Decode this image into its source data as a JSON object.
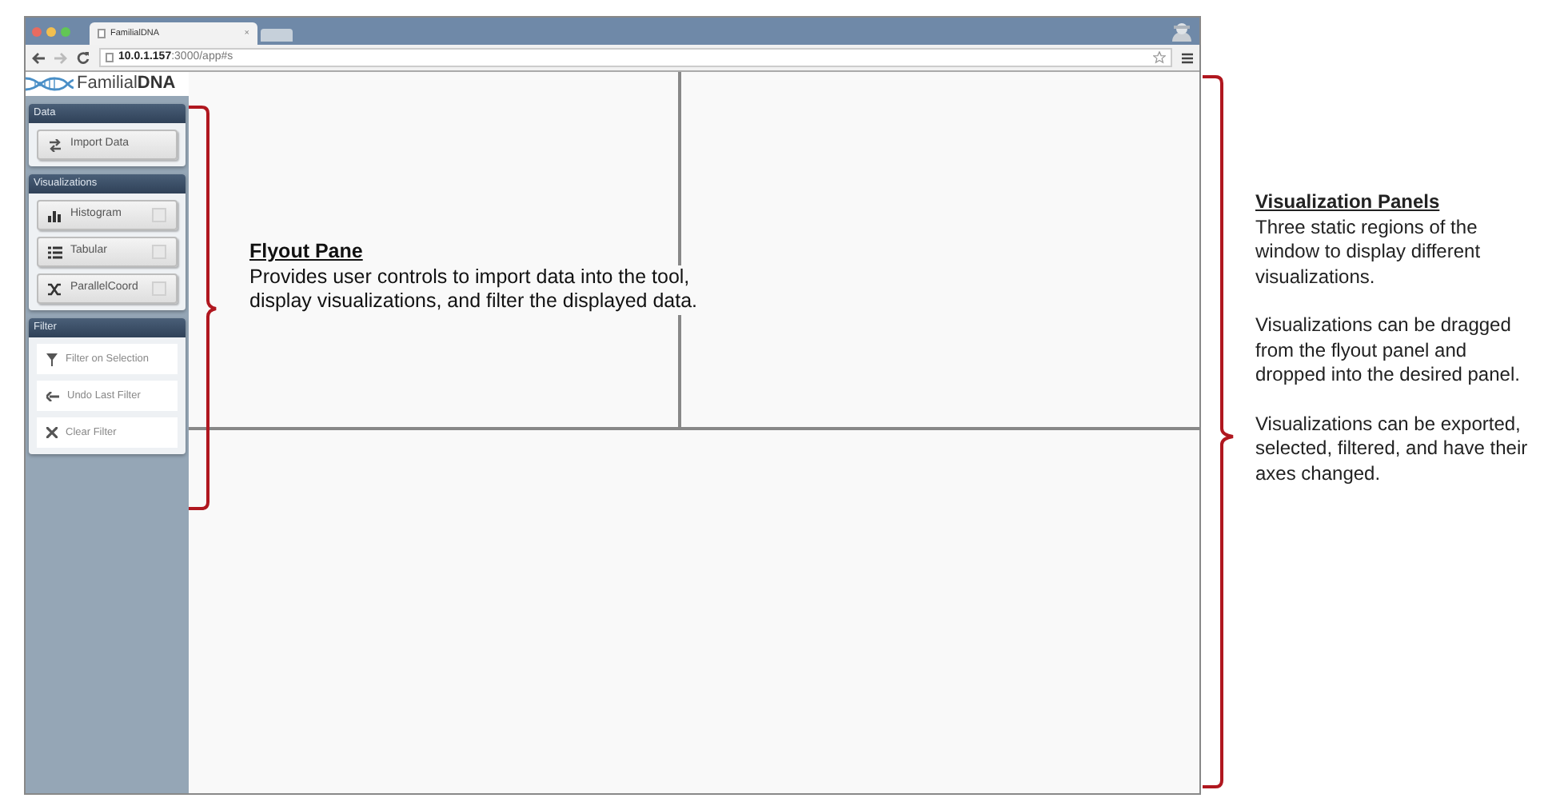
{
  "browser": {
    "tab_title": "FamilialDNA",
    "tab_close": "×",
    "url_host": "10.0.1.157",
    "url_path": ":3000/app#s"
  },
  "logo": {
    "light": "Familial",
    "bold": "DNA"
  },
  "sidebar": {
    "sections": [
      {
        "title": "Data",
        "items": [
          {
            "kind": "button",
            "label": "Import Data"
          }
        ]
      },
      {
        "title": "Visualizations",
        "items": [
          {
            "kind": "draggable",
            "label": "Histogram"
          },
          {
            "kind": "draggable",
            "label": "Tabular"
          },
          {
            "kind": "draggable",
            "label": "ParallelCoord"
          }
        ]
      },
      {
        "title": "Filter",
        "items": [
          {
            "kind": "action",
            "label": "Filter on Selection"
          },
          {
            "kind": "action",
            "label": "Undo Last Filter"
          },
          {
            "kind": "action",
            "label": "Clear Filter"
          }
        ]
      }
    ]
  },
  "annotations": [
    {
      "title": "Flyout Pane",
      "paragraphs": [
        "Provides user controls to import data into the tool, display visualizations, and filter the displayed data."
      ]
    },
    {
      "title": "Visualization Panels",
      "paragraphs": [
        "Three static regions of the window to display different visualizations.",
        "Visualizations can be dragged from the flyout panel and dropped into the desired panel.",
        "Visualizations can be exported, selected, filtered, and have their axes changed."
      ]
    }
  ]
}
